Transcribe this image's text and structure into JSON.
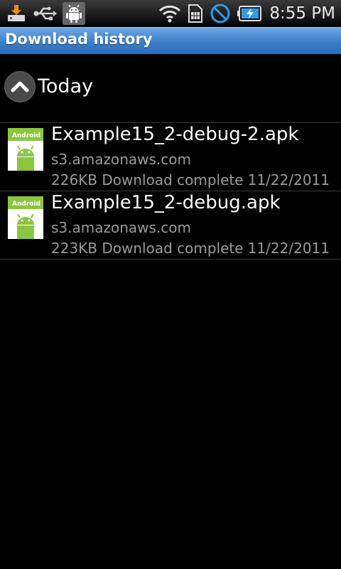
{
  "status_bar": {
    "time": "8:55 PM",
    "left_icons": [
      "download-notification-icon",
      "usb-icon",
      "android-debug-icon"
    ],
    "right_icons": [
      "wifi-icon",
      "sim-card-icon",
      "no-signal-icon",
      "battery-charging-icon"
    ]
  },
  "title_bar": {
    "title": "Download history"
  },
  "group": {
    "label": "Today",
    "collapse_icon": "chevron-up-icon"
  },
  "downloads": [
    {
      "icon": "android-apk-icon",
      "icon_label": "Android",
      "filename": "Example15_2-debug-2.apk",
      "host": "s3.amazonaws.com",
      "status": "226KB Download complete",
      "date": "11/22/2011"
    },
    {
      "icon": "android-apk-icon",
      "icon_label": "Android",
      "filename": "Example15_2-debug.apk",
      "host": "s3.amazonaws.com",
      "status": "223KB Download complete",
      "date": "11/22/2011"
    }
  ],
  "colors": {
    "title_bar": "#3b7fc9",
    "secondary_text": "#9a9a9a",
    "divider": "#3a3a3a",
    "apk_green": "#8cc63f"
  }
}
